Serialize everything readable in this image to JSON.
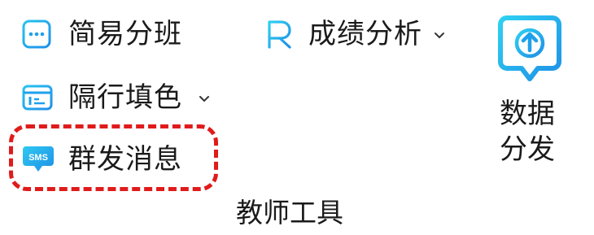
{
  "menu": {
    "simple_class": {
      "label": "简易分班",
      "icon": "dots-square-icon"
    },
    "grade_analysis": {
      "label": "成绩分析",
      "icon": "r-letter-icon",
      "has_dropdown": true
    },
    "zebra_fill": {
      "label": "隔行填色",
      "icon": "table-rows-icon",
      "has_dropdown": true
    },
    "group_sms": {
      "label": "群发消息",
      "icon": "sms-bubble-icon",
      "icon_text": "SMS"
    }
  },
  "data_distribution": {
    "label": "数据分发",
    "icon": "upload-arrow-bubble-icon"
  },
  "group_title": "教师工具",
  "colors": {
    "accent": "#1aa7ec",
    "highlight": "#e01b1b"
  }
}
